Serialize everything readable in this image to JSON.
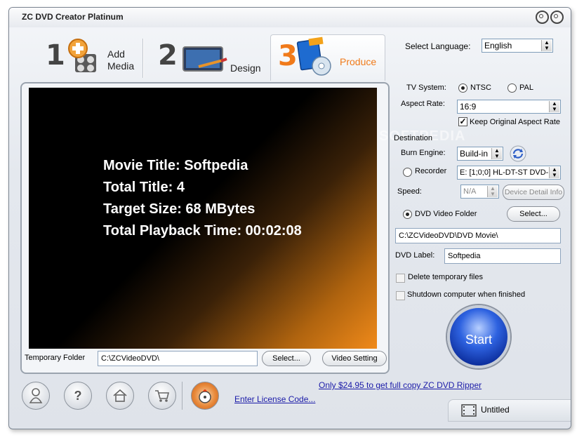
{
  "window": {
    "title": "ZC DVD Creator Platinum"
  },
  "tabs": [
    {
      "number": "1",
      "label_line1": "Add",
      "label_line2": "Media"
    },
    {
      "number": "2",
      "label": "Design"
    },
    {
      "number": "3",
      "label": "Produce"
    }
  ],
  "language": {
    "label": "Select Language:",
    "value": "English"
  },
  "preview": {
    "lines": [
      "Movie Title: Softpedia",
      "Total Title: 4",
      "Target Size: 68 MBytes",
      "Total Playback Time: 00:02:08"
    ]
  },
  "temp_folder": {
    "label": "Temporary Folder",
    "value": "C:\\ZCVideoDVD\\",
    "select_label": "Select...",
    "video_setting_label": "Video Setting"
  },
  "settings": {
    "tv_system_label": "TV System:",
    "ntsc_label": "NTSC",
    "pal_label": "PAL",
    "tv_system_selected": "NTSC",
    "aspect_rate_label": "Aspect Rate:",
    "aspect_rate_value": "16:9",
    "keep_aspect_label": "Keep Original Aspect Rate",
    "keep_aspect_checked": true,
    "destination_label": "Destination",
    "burn_engine_label": "Burn Engine:",
    "burn_engine_value": "Build-in",
    "recorder_label": "Recorder",
    "recorder_value": "E:  [1;0;0] HL-DT-ST DVD-",
    "speed_label": "Speed:",
    "speed_value": "N/A",
    "device_detail_label": "Device Detail Info",
    "dvd_folder_label": "DVD Video Folder",
    "dvd_folder_select_label": "Select...",
    "dvd_folder_path": "C:\\ZCVideoDVD\\DVD Movie\\",
    "dvd_label_label": "DVD Label:",
    "dvd_label_value": "Softpedia",
    "delete_temp_label": "Delete temporary files",
    "shutdown_label": "Shutdown computer when finished",
    "start_label": "Start"
  },
  "footer": {
    "promo_link": "Only $24.95 to get full copy ZC DVD Ripper",
    "license_link": "Enter License Code...",
    "project_name": "Untitled"
  },
  "watermark": "SOFTPEDIA"
}
